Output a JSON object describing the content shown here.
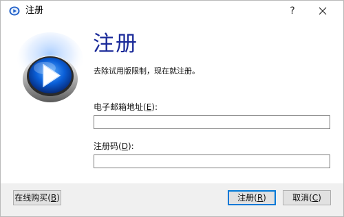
{
  "window": {
    "title": "注册",
    "help_label": "?",
    "close_label": "×"
  },
  "main": {
    "heading": "注册",
    "subtitle": "去除试用版限制，现在就注册。",
    "email_label_prefix": "电子邮箱地址(",
    "email_label_mnemonic": "E",
    "email_label_suffix": "):",
    "email_value": "",
    "code_label_prefix": "注册码(",
    "code_label_mnemonic": "D",
    "code_label_suffix": "):",
    "code_value": ""
  },
  "footer": {
    "buy_prefix": "在线购买(",
    "buy_mnemonic": "B",
    "buy_suffix": ")",
    "register_prefix": "注册(",
    "register_mnemonic": "R",
    "register_suffix": ")",
    "cancel_prefix": "取消(",
    "cancel_mnemonic": "C",
    "cancel_suffix": ")"
  },
  "colors": {
    "heading": "#1a2a99",
    "default_button_border": "#0078d7",
    "footer_bg": "#f0f0f0"
  },
  "icons": {
    "app_icon": "play-disc-icon",
    "logo": "play-disc-logo",
    "close": "close-icon"
  }
}
